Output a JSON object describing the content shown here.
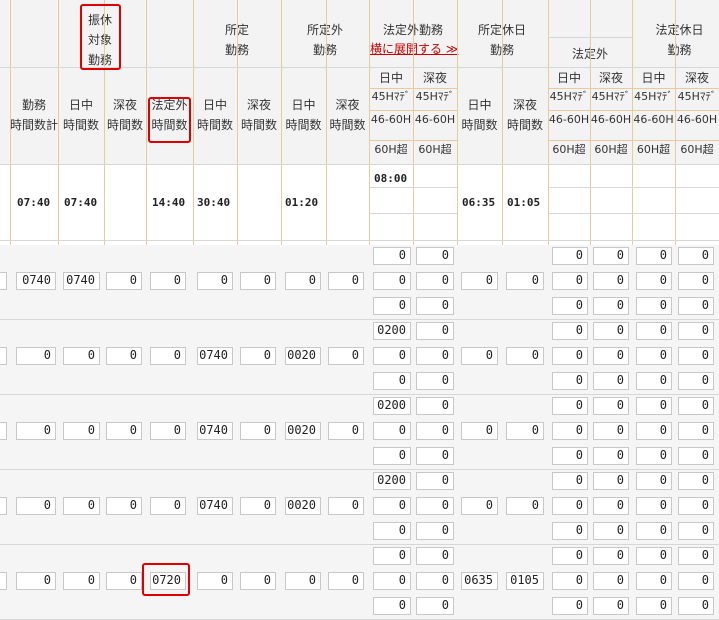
{
  "header": {
    "furikyu": [
      "振休",
      "対象",
      "勤務"
    ],
    "shotei": [
      "所定",
      "勤務"
    ],
    "shoteigai": [
      "所定外",
      "勤務"
    ],
    "hoteigai": "法定外勤務",
    "expand_link": "横に展開する ≫",
    "shotei_kyujitsu": [
      "所定休日",
      "勤務"
    ],
    "hotei_kyujitsu": [
      "法定休日",
      "勤務"
    ],
    "hoteigai_sub": "法定外"
  },
  "subheader": {
    "kinmu_jikan_kei": [
      "勤務",
      "時間数計"
    ],
    "nicchu_jikan": [
      "日中",
      "時間数"
    ],
    "shinya_jikan": [
      "深夜",
      "時間数"
    ],
    "hoteigai_jikan": [
      "法定外",
      "時間数"
    ],
    "nicchu": "日中",
    "shinya": "深夜",
    "m45": "45Hﾏﾃﾞ",
    "m46": "46-60H",
    "m60": "60H超"
  },
  "summary": {
    "kinmu": "07:40",
    "nicchu": "07:40",
    "hoteigai": "14:40",
    "shotei_nicchu": "30:40",
    "shoteigai_nicchu": "01:20",
    "hoteigai_nicchu_45": "08:00",
    "kyujitsu_nicchu": "06:35",
    "kyujitsu_shinya": "01:05"
  },
  "rows": [
    {
      "kinmu": "0740",
      "nicchu": "0740",
      "shinya": "0",
      "hoteigai": "0",
      "shotei_n": "0",
      "shotei_s": "0",
      "shoteigai_n": "0",
      "shoteigai_s": "0",
      "hg": [
        [
          "0",
          "0"
        ],
        [
          "0",
          "0"
        ],
        [
          "0",
          "0"
        ]
      ],
      "kyu_n": "0",
      "kyu_s": "0",
      "hk": [
        [
          "0",
          "0",
          "0",
          "0"
        ],
        [
          "0",
          "0",
          "0",
          "0"
        ],
        [
          "0",
          "0",
          "0",
          "0"
        ]
      ]
    },
    {
      "kinmu": "0",
      "nicchu": "0",
      "shinya": "0",
      "hoteigai": "0",
      "shotei_n": "0740",
      "shotei_s": "0",
      "shoteigai_n": "0020",
      "shoteigai_s": "0",
      "hg": [
        [
          "0200",
          "0"
        ],
        [
          "0",
          "0"
        ],
        [
          "0",
          "0"
        ]
      ],
      "kyu_n": "0",
      "kyu_s": "0",
      "hk": [
        [
          "0",
          "0",
          "0",
          "0"
        ],
        [
          "0",
          "0",
          "0",
          "0"
        ],
        [
          "0",
          "0",
          "0",
          "0"
        ]
      ]
    },
    {
      "kinmu": "0",
      "nicchu": "0",
      "shinya": "0",
      "hoteigai": "0",
      "shotei_n": "0740",
      "shotei_s": "0",
      "shoteigai_n": "0020",
      "shoteigai_s": "0",
      "hg": [
        [
          "0200",
          "0"
        ],
        [
          "0",
          "0"
        ],
        [
          "0",
          "0"
        ]
      ],
      "kyu_n": "0",
      "kyu_s": "0",
      "hk": [
        [
          "0",
          "0",
          "0",
          "0"
        ],
        [
          "0",
          "0",
          "0",
          "0"
        ],
        [
          "0",
          "0",
          "0",
          "0"
        ]
      ]
    },
    {
      "kinmu": "0",
      "nicchu": "0",
      "shinya": "0",
      "hoteigai": "0",
      "shotei_n": "0740",
      "shotei_s": "0",
      "shoteigai_n": "0020",
      "shoteigai_s": "0",
      "hg": [
        [
          "0200",
          "0"
        ],
        [
          "0",
          "0"
        ],
        [
          "0",
          "0"
        ]
      ],
      "kyu_n": "0",
      "kyu_s": "0",
      "hk": [
        [
          "0",
          "0",
          "0",
          "0"
        ],
        [
          "0",
          "0",
          "0",
          "0"
        ],
        [
          "0",
          "0",
          "0",
          "0"
        ]
      ]
    },
    {
      "kinmu": "0",
      "nicchu": "0",
      "shinya": "0",
      "hoteigai": "0720",
      "shotei_n": "0",
      "shotei_s": "0",
      "shoteigai_n": "0",
      "shoteigai_s": "0",
      "hg": [
        [
          "0",
          "0"
        ],
        [
          "0",
          "0"
        ],
        [
          "0",
          "0"
        ]
      ],
      "kyu_n": "0635",
      "kyu_s": "0105",
      "hk": [
        [
          "0",
          "0",
          "0",
          "0"
        ],
        [
          "0",
          "0",
          "0",
          "0"
        ],
        [
          "0",
          "0",
          "0",
          "0"
        ]
      ]
    }
  ]
}
